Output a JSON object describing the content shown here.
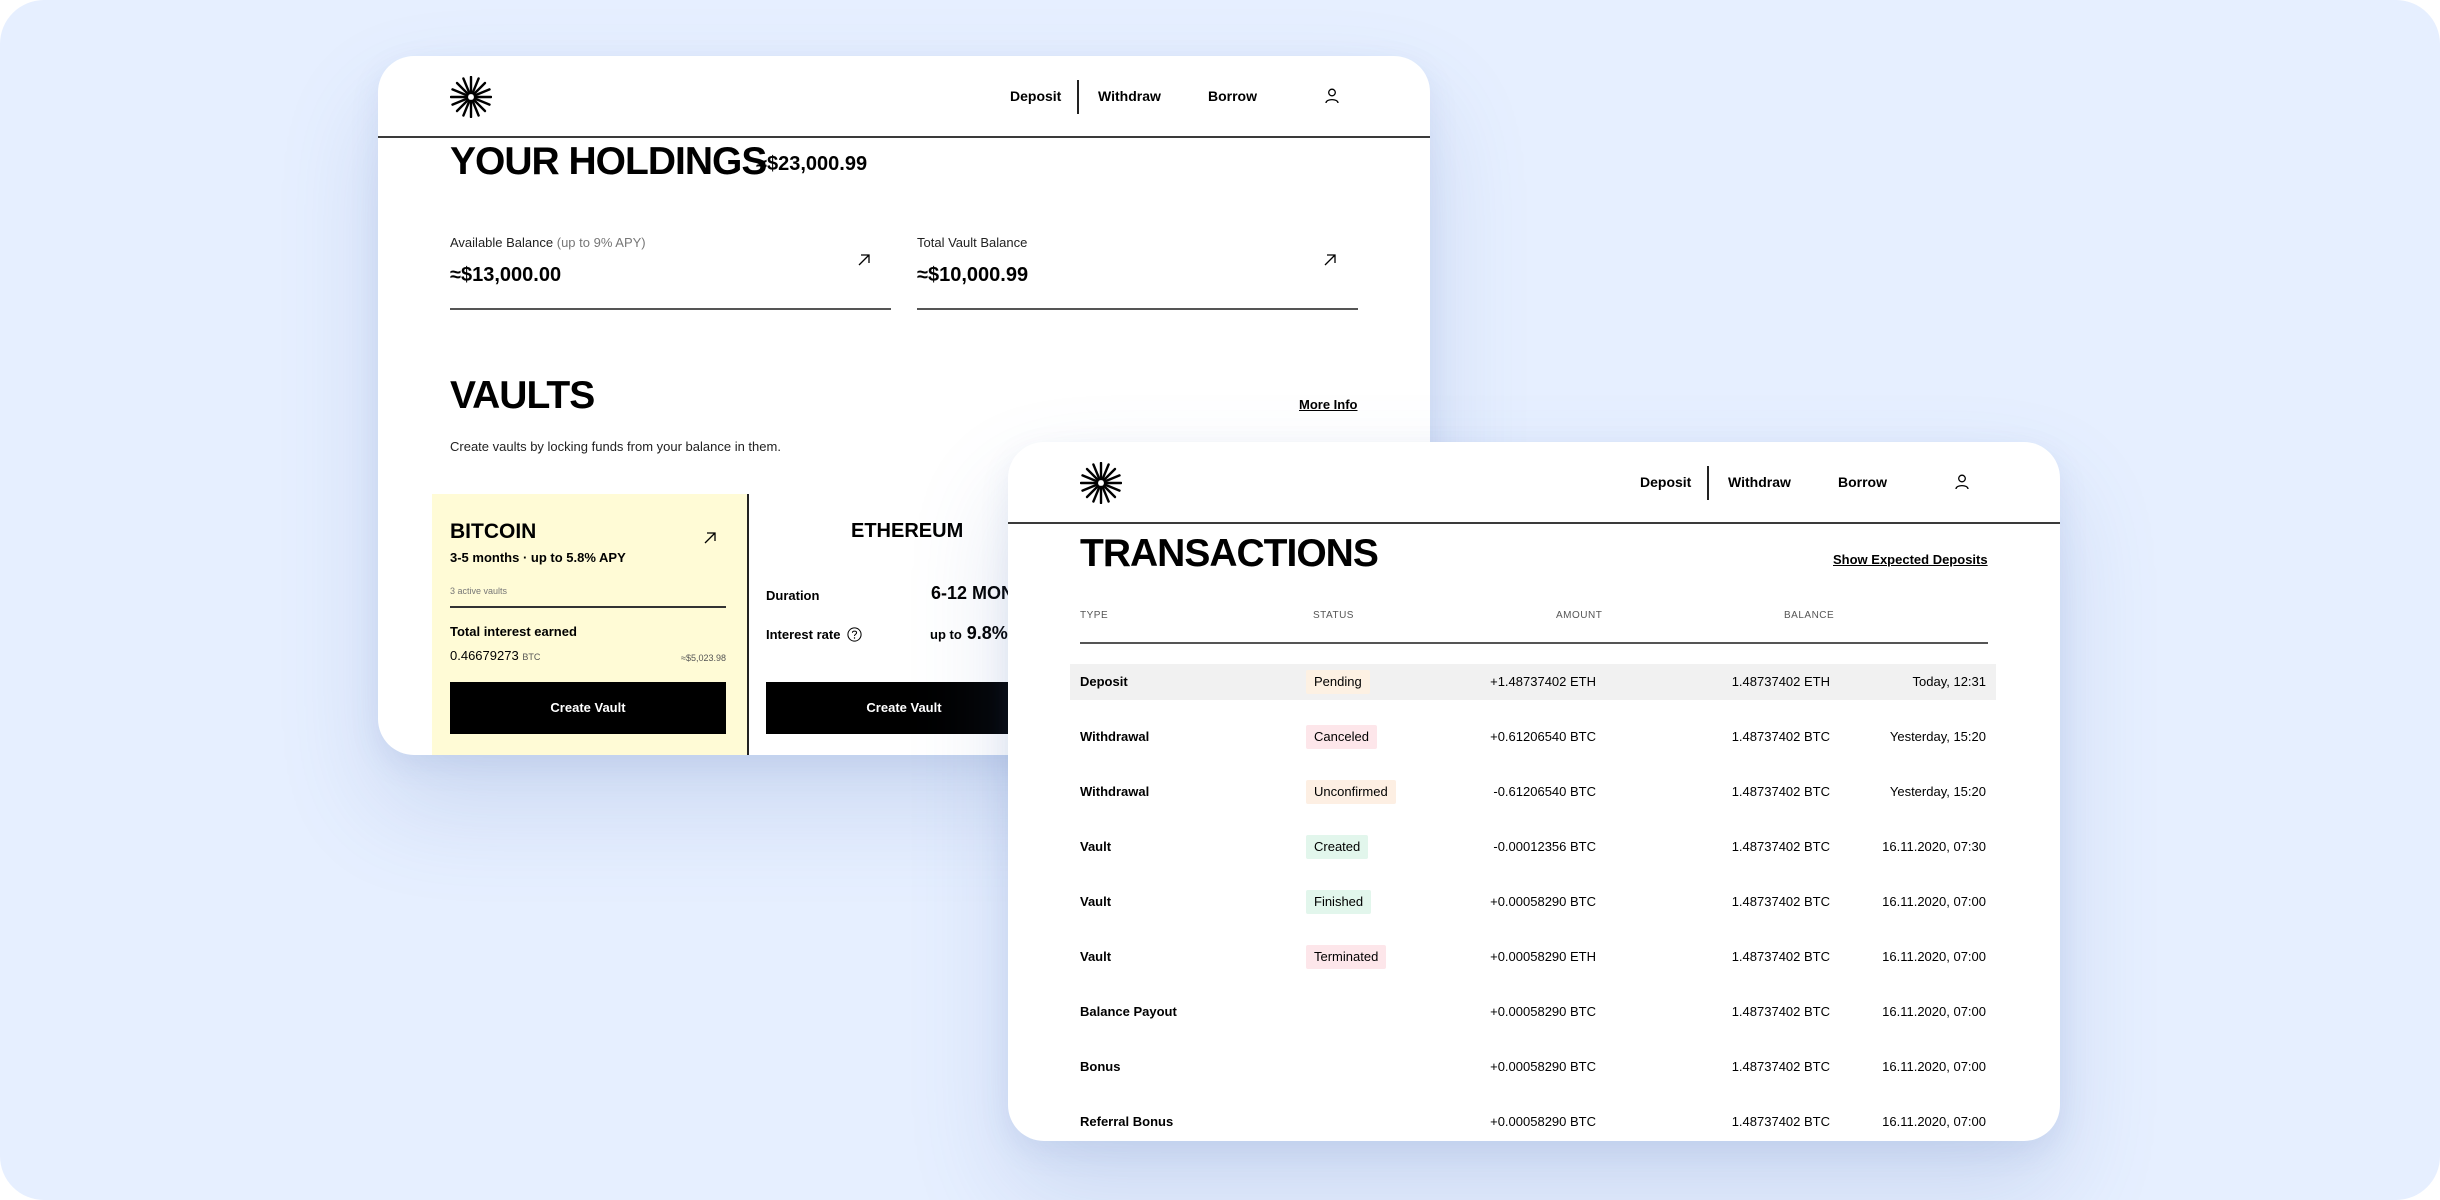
{
  "colors": {
    "background": "#e6efff",
    "vault_highlight": "#fffbd6",
    "pending": "#fdf1e3",
    "canceled": "#fde6ea",
    "unconfirmed": "#fdefe3",
    "created": "#e2f6ec",
    "finished": "#e2f6ec",
    "terminated": "#fde6ea"
  },
  "nav": {
    "deposit": "Deposit",
    "withdraw": "Withdraw",
    "borrow": "Borrow",
    "logo_icon": "starburst-logo-icon",
    "user_icon": "user-icon"
  },
  "holdings": {
    "title": "YOUR HOLDINGS",
    "total": "≈$23,000.99",
    "available": {
      "label": "Available Balance",
      "note": "(up to 9% APY)",
      "value": "≈$13,000.00"
    },
    "vault": {
      "label": "Total Vault Balance",
      "value": "≈$10,000.99"
    }
  },
  "vaults": {
    "title": "VAULTS",
    "more_info": "More Info",
    "description": "Create vaults by locking funds from your balance in them.",
    "bitcoin": {
      "title": "BITCOIN",
      "subtitle": "3-5 months · up to 5.8% APY",
      "active": "3 active vaults",
      "interest_label": "Total interest earned",
      "interest_amount": "0.46679273",
      "interest_unit": "BTC",
      "interest_fiat": "≈$5,023.98",
      "button": "Create Vault"
    },
    "ethereum": {
      "title": "ETHEREUM",
      "duration_label": "Duration",
      "duration_value": "6-12 MON",
      "rate_label": "Interest rate",
      "rate_prefix": "up to",
      "rate_value": "9.8%",
      "button": "Create Vault"
    }
  },
  "transactions": {
    "title": "TRANSACTIONS",
    "show_expected": "Show Expected Deposits",
    "headers": {
      "type": "TYPE",
      "status": "STATUS",
      "amount": "AMOUNT",
      "balance": "BALANCE"
    },
    "rows": [
      {
        "type": "Deposit",
        "status": "Pending",
        "amount": "+1.48737402 ETH",
        "balance": "1.48737402 ETH",
        "date": "Today, 12:31"
      },
      {
        "type": "Withdrawal",
        "status": "Canceled",
        "amount": "+0.61206540 BTC",
        "balance": "1.48737402 BTC",
        "date": "Yesterday, 15:20"
      },
      {
        "type": "Withdrawal",
        "status": "Unconfirmed",
        "amount": "-0.61206540 BTC",
        "balance": "1.48737402 BTC",
        "date": "Yesterday, 15:20"
      },
      {
        "type": "Vault",
        "status": "Created",
        "amount": "-0.00012356 BTC",
        "balance": "1.48737402 BTC",
        "date": "16.11.2020, 07:30"
      },
      {
        "type": "Vault",
        "status": "Finished",
        "amount": "+0.00058290 BTC",
        "balance": "1.48737402 BTC",
        "date": "16.11.2020, 07:00"
      },
      {
        "type": "Vault",
        "status": "Terminated",
        "amount": "+0.00058290 ETH",
        "balance": "1.48737402 BTC",
        "date": "16.11.2020, 07:00"
      },
      {
        "type": "Balance Payout",
        "status": "",
        "amount": "+0.00058290 BTC",
        "balance": "1.48737402 BTC",
        "date": "16.11.2020, 07:00"
      },
      {
        "type": "Bonus",
        "status": "",
        "amount": "+0.00058290 BTC",
        "balance": "1.48737402 BTC",
        "date": "16.11.2020, 07:00"
      },
      {
        "type": "Referral Bonus",
        "status": "",
        "amount": "+0.00058290 BTC",
        "balance": "1.48737402 BTC",
        "date": "16.11.2020, 07:00"
      }
    ]
  }
}
